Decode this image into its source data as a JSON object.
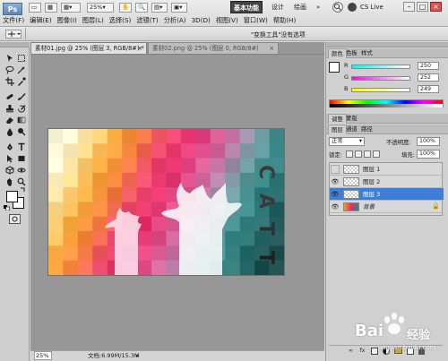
{
  "app": {
    "logo_text": "Ps",
    "zoom_display": "25%",
    "workspace": {
      "active": "基本功能",
      "items": [
        "设计",
        "绘画"
      ],
      "more": "»"
    },
    "cs_live": "CS Live",
    "window_controls": [
      "–",
      "□",
      "×"
    ]
  },
  "menu": [
    "文件(F)",
    "编辑(E)",
    "图像(I)",
    "图层(L)",
    "选择(S)",
    "滤镜(T)",
    "分析(A)",
    "3D(D)",
    "视图(V)",
    "窗口(W)",
    "帮助(H)"
  ],
  "options_bar": {
    "text": "\"变换工具\"没有选项"
  },
  "documents": {
    "tabs": [
      {
        "label": "素材01.jpg @ 25% (图层 3, RGB/8#) *",
        "close": "×"
      },
      {
        "label": "素材02.png @ 25% (图层 0, RGB/8#)",
        "close": "×"
      }
    ],
    "canvas_text": [
      "C",
      "A",
      "T",
      "T"
    ],
    "status": {
      "zoom": "25%",
      "info": "文档:6.99M/15.3M"
    }
  },
  "color_panel": {
    "tabs": [
      "颜色",
      "色板",
      "样式"
    ],
    "rows": [
      {
        "label": "R",
        "value": "250",
        "color": "#e04040"
      },
      {
        "label": "G",
        "value": "252",
        "color": "#40c040"
      },
      {
        "label": "B",
        "value": "249",
        "color": "#4060e0"
      }
    ]
  },
  "adjust_panel": {
    "tabs": [
      "调整",
      "蒙版"
    ]
  },
  "layers_panel": {
    "tabs": [
      "图层",
      "通道",
      "路径"
    ],
    "blend_mode": "正常",
    "opacity_label": "不透明度:",
    "opacity_value": "100%",
    "lock_label": "锁定:",
    "fill_label": "填充:",
    "fill_value": "100%",
    "layers": [
      {
        "name": "图层 1",
        "selected": false,
        "visible": false
      },
      {
        "name": "图层 2",
        "selected": false,
        "visible": true
      },
      {
        "name": "图层 3",
        "selected": true,
        "visible": true
      },
      {
        "name": "背景",
        "selected": false,
        "visible": true,
        "locked": true
      }
    ],
    "footer_icons": [
      "link-icon",
      "fx-icon",
      "mask-icon",
      "adjustment-icon",
      "group-icon",
      "new-layer-icon",
      "trash-icon"
    ]
  },
  "watermark": {
    "brand": "Bai",
    "brand2": "经验",
    "url": "jingyan.baidu.com"
  },
  "colors": {
    "selected_layer": "#3d7fd8",
    "foreground": "#ffffff",
    "background": "#ffffff",
    "accent": "#2a64c8"
  }
}
